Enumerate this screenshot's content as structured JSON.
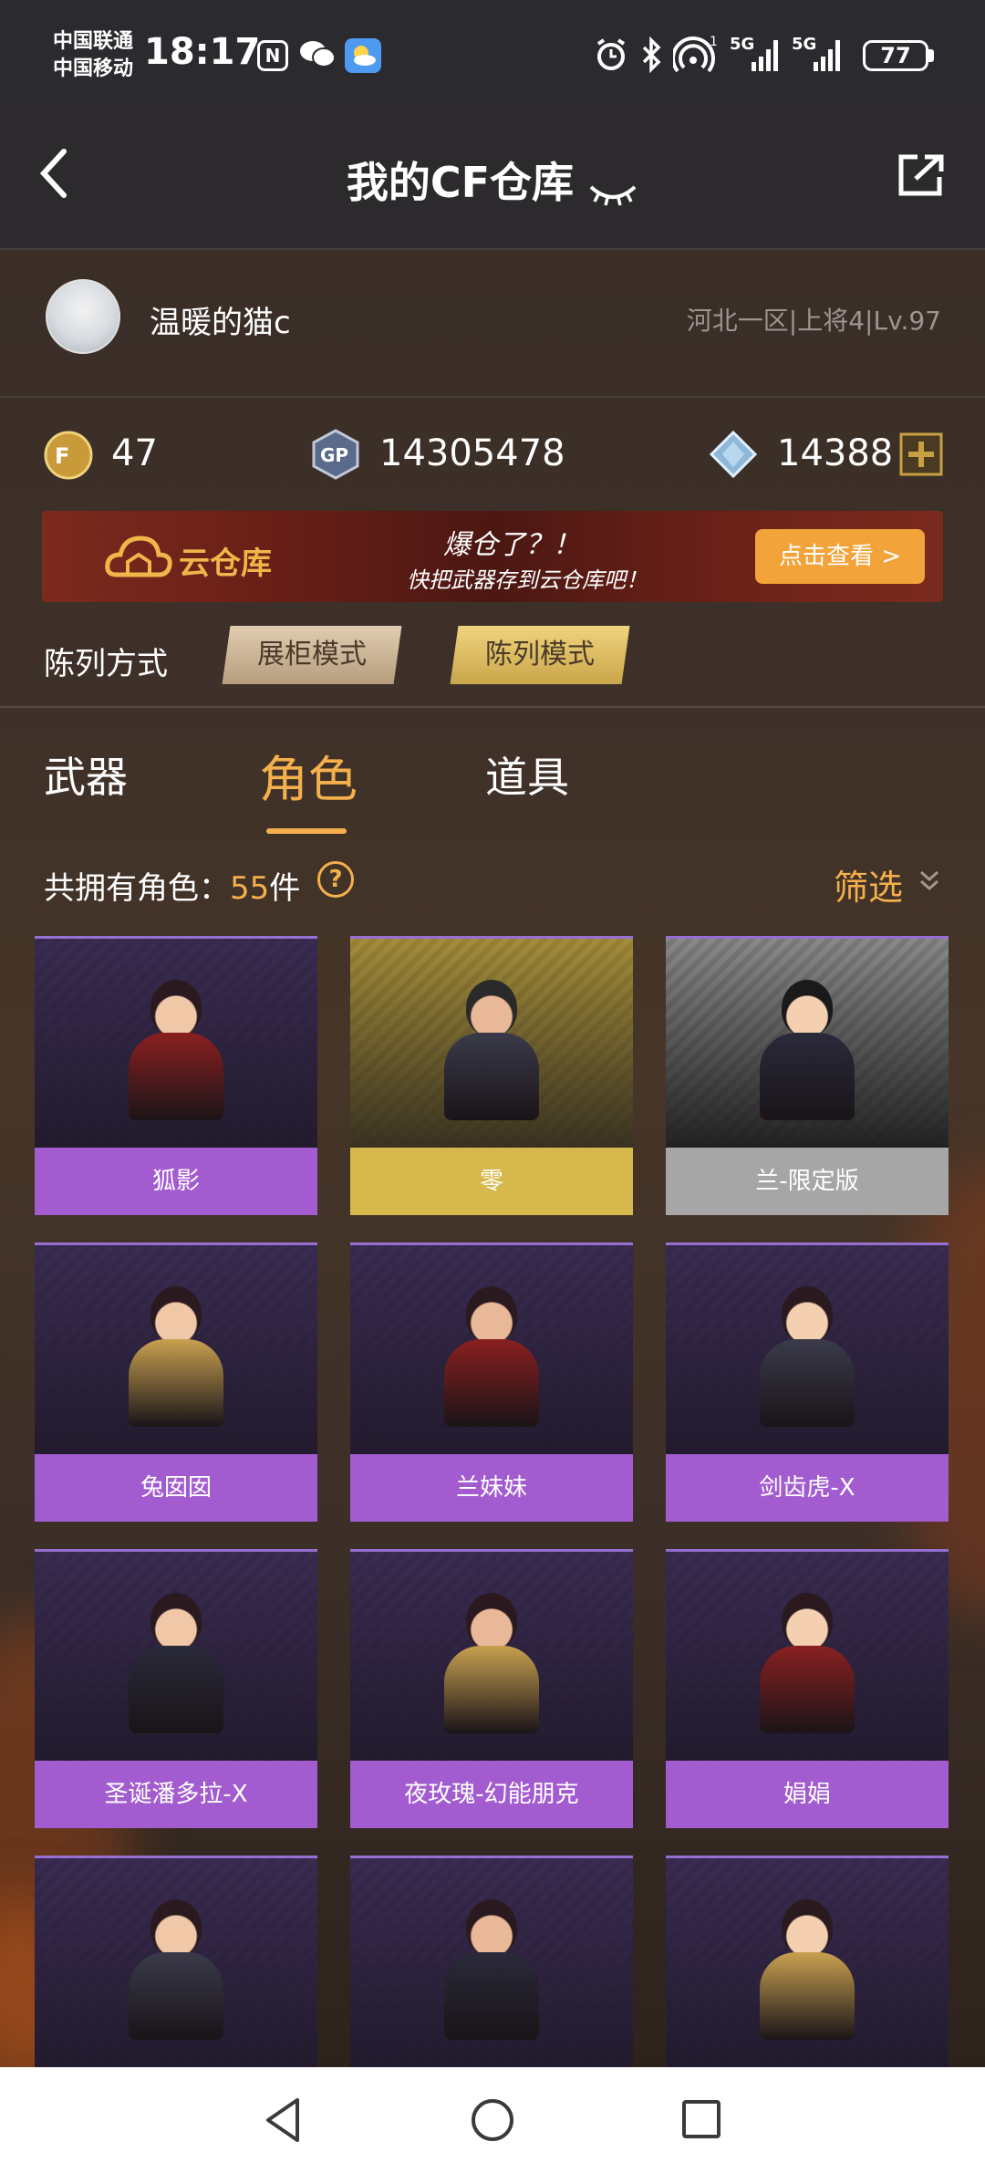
{
  "status_bar": {
    "carrier1": "中国联通",
    "carrier2": "中国移动",
    "time": "18:17",
    "nfc_label": "N",
    "signal1_label": "5G",
    "signal2_label": "5G",
    "battery": "77"
  },
  "header": {
    "title": "我的CF仓库"
  },
  "profile": {
    "name": "温暖的猫c",
    "server": "河北一区|上将4|Lv.97"
  },
  "currency": {
    "cf_value": "47",
    "gp_label": "GP",
    "gp_value": "14305478",
    "diamond_value": "14388"
  },
  "banner": {
    "cloud_label": "云仓库",
    "line1": "爆仓了？！",
    "line2": "快把武器存到云仓库吧！",
    "button": "点击查看 >"
  },
  "display_mode": {
    "label": "陈列方式",
    "options": [
      "展柜模式",
      "陈列模式"
    ]
  },
  "tabs": [
    "武器",
    "角色",
    "道具"
  ],
  "count": {
    "prefix": "共拥有角色：",
    "number": "55",
    "suffix": "件",
    "help": "?"
  },
  "filter": {
    "label": "筛选"
  },
  "characters": [
    {
      "name": "狐影",
      "rarity": "purple"
    },
    {
      "name": "零",
      "rarity": "gold"
    },
    {
      "name": "兰-限定版",
      "rarity": "grey"
    },
    {
      "name": "兔囡囡",
      "rarity": "purple"
    },
    {
      "name": "兰妹妹",
      "rarity": "purple"
    },
    {
      "name": "剑齿虎-X",
      "rarity": "purple"
    },
    {
      "name": "圣诞潘多拉-X",
      "rarity": "purple"
    },
    {
      "name": "夜玫瑰-幻能朋克",
      "rarity": "purple"
    },
    {
      "name": "娟娟",
      "rarity": "purple"
    },
    {
      "name": "",
      "rarity": "purple"
    },
    {
      "name": "",
      "rarity": "purple"
    },
    {
      "name": "",
      "rarity": "purple"
    }
  ],
  "colors": {
    "accent": "#f4b04c",
    "purple_tag": "#a35cd0",
    "gold_tag": "#d6b84c",
    "grey_tag": "#a6a6a6"
  }
}
